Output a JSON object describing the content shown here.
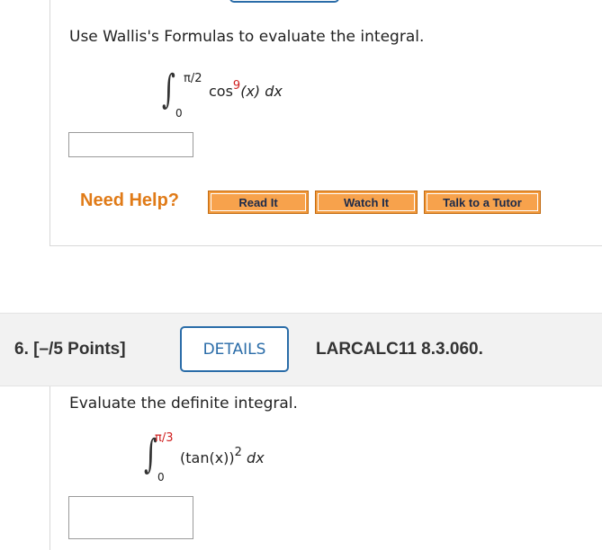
{
  "question5": {
    "prompt": "Use Wallis's Formulas to evaluate the integral.",
    "integral": {
      "upper": "π/2",
      "lower": "0",
      "func": "cos",
      "exponent": "9",
      "arg": "(x)",
      "dx": "dx"
    },
    "answer_value": "",
    "need_help_label": "Need Help?",
    "buttons": {
      "read_it": "Read It",
      "watch_it": "Watch It",
      "talk_to_tutor": "Talk to a Tutor"
    }
  },
  "question6": {
    "number_label": "6.",
    "points_label": "[–/5 Points]",
    "details_label": "DETAILS",
    "source_label": "LARCALC11 8.3.060.",
    "prompt": "Evaluate the definite integral.",
    "integral": {
      "upper": "π/3",
      "lower": "0",
      "integrand": "(tan(x))",
      "exponent": "2",
      "dx": "dx"
    },
    "answer_value": ""
  },
  "colors": {
    "accent_blue": "#2a6ca8",
    "help_orange": "#e07b18",
    "button_orange": "#f7a24c",
    "red_highlight": "#d02020",
    "header_gray": "#f2f2f2"
  }
}
